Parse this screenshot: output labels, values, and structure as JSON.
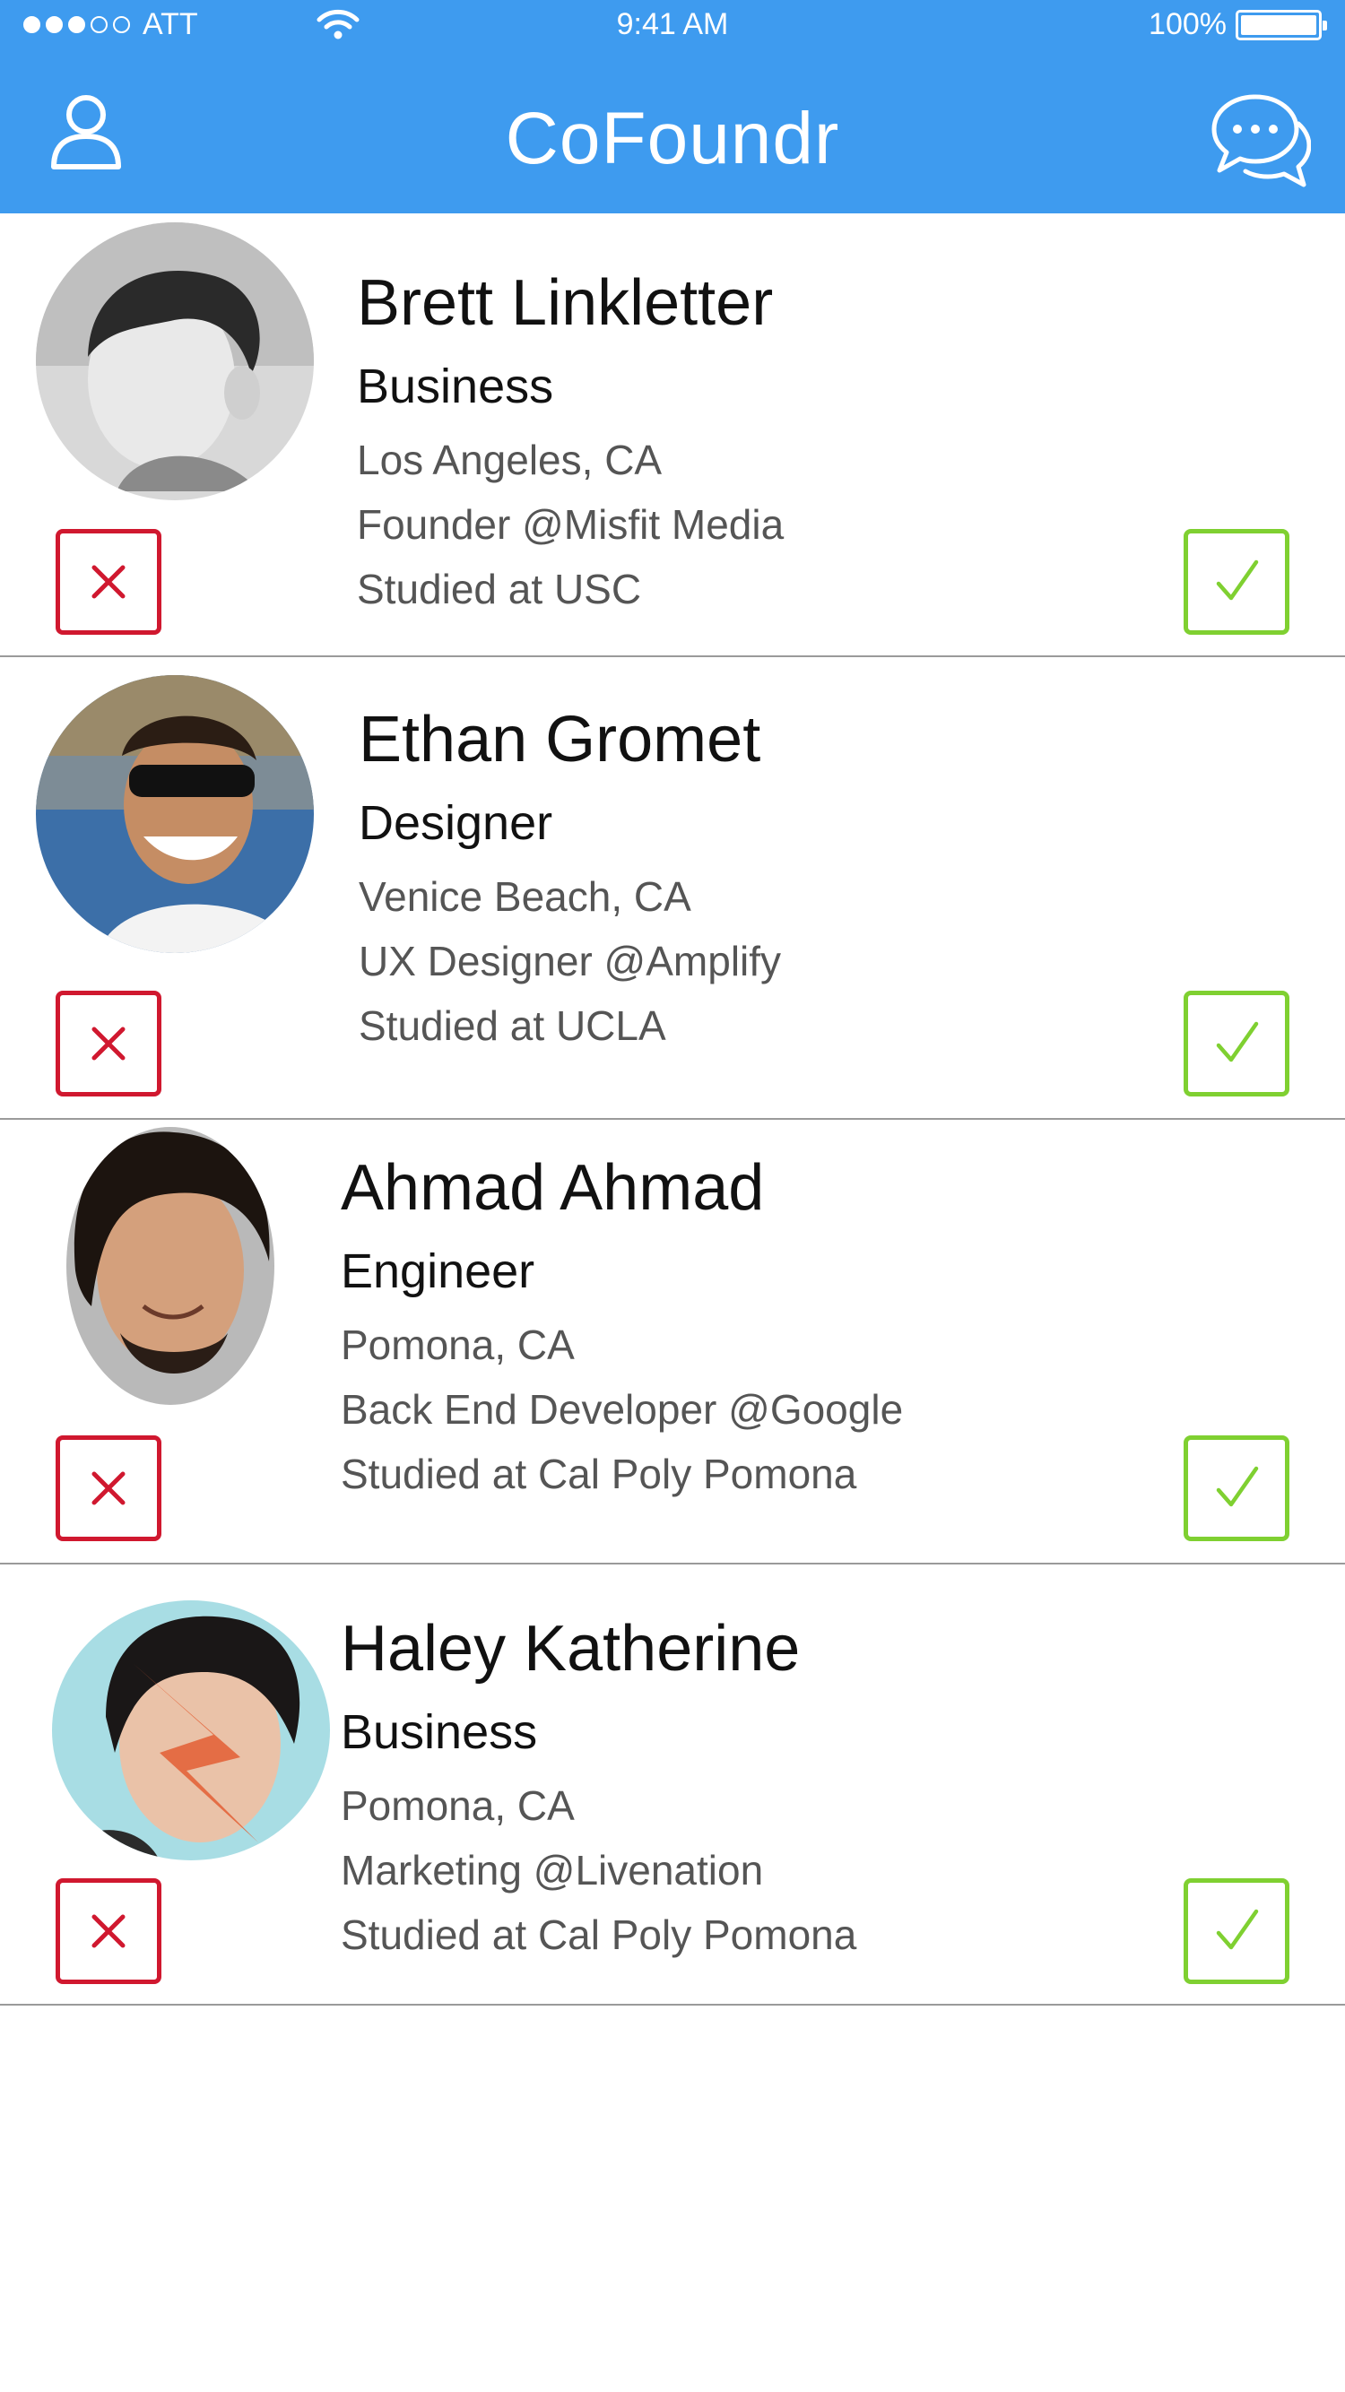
{
  "status_bar": {
    "carrier": "ATT",
    "time": "9:41 AM",
    "battery": "100%"
  },
  "nav": {
    "title": "CoFoundr",
    "left_icon": "person-icon",
    "right_icon": "chat-bubbles-icon"
  },
  "colors": {
    "header": "#3e9bef",
    "reject": "#d0182f",
    "accept": "#7fd031"
  },
  "profiles": [
    {
      "name": "Brett Linkletter",
      "role": "Business",
      "location": "Los Angeles, CA",
      "position": "Founder @Misfit Media",
      "education": "Studied at USC"
    },
    {
      "name": "Ethan Gromet",
      "role": "Designer",
      "location": "Venice Beach, CA",
      "position": "UX Designer @Amplify",
      "education": "Studied at UCLA"
    },
    {
      "name": "Ahmad Ahmad",
      "role": "Engineer",
      "location": "Pomona, CA",
      "position": "Back End Developer @Google",
      "education": "Studied at Cal Poly Pomona"
    },
    {
      "name": "Haley Katherine",
      "role": "Business",
      "location": "Pomona, CA",
      "position": "Marketing @Livenation",
      "education": "Studied at Cal Poly Pomona"
    }
  ]
}
